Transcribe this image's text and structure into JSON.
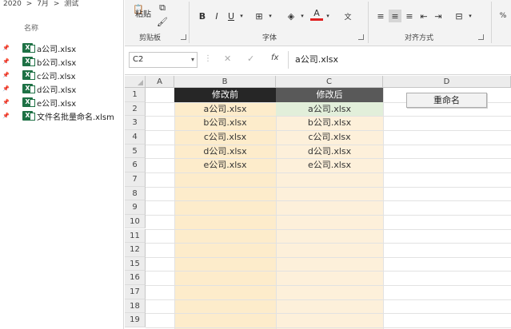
{
  "explorer": {
    "breadcrumb": [
      "2020",
      ">",
      "7月",
      ">",
      "测试"
    ],
    "column_name": "名称",
    "files": [
      {
        "name": "a公司.xlsx",
        "icon": "excel-file-icon"
      },
      {
        "name": "b公司.xlsx",
        "icon": "excel-file-icon"
      },
      {
        "name": "c公司.xlsx",
        "icon": "excel-file-icon"
      },
      {
        "name": "d公司.xlsx",
        "icon": "excel-file-icon"
      },
      {
        "name": "e公司.xlsx",
        "icon": "excel-file-icon"
      },
      {
        "name": "文件名批量命名.xlsm",
        "icon": "excel-file-icon"
      }
    ],
    "pin_glyph": "📌"
  },
  "ribbon": {
    "paste_label": "粘贴",
    "clipboard_group": "剪贴板",
    "font_group": "字体",
    "align_group": "对齐方式",
    "bold": "B",
    "italic": "I",
    "underline": "U",
    "font_color_letter": "A",
    "font_color": "#e02020"
  },
  "formula_bar": {
    "name_box": "C2",
    "fx_label": "fx",
    "content": "a公司.xlsx"
  },
  "sheet": {
    "columns": [
      "A",
      "B",
      "C",
      "D"
    ],
    "rows": [
      "1",
      "2",
      "3",
      "4",
      "5",
      "6",
      "7",
      "8",
      "9",
      "10",
      "11",
      "12",
      "15",
      "16",
      "17",
      "18",
      "19"
    ],
    "header_before": "修改前",
    "header_after": "修改后",
    "before": [
      "a公司.xlsx",
      "b公司.xlsx",
      "c公司.xlsx",
      "d公司.xlsx",
      "e公司.xlsx"
    ],
    "after": [
      "a公司.xlsx",
      "b公司.xlsx",
      "c公司.xlsx",
      "d公司.xlsx",
      "e公司.xlsx"
    ],
    "rename_button": "重命名"
  }
}
